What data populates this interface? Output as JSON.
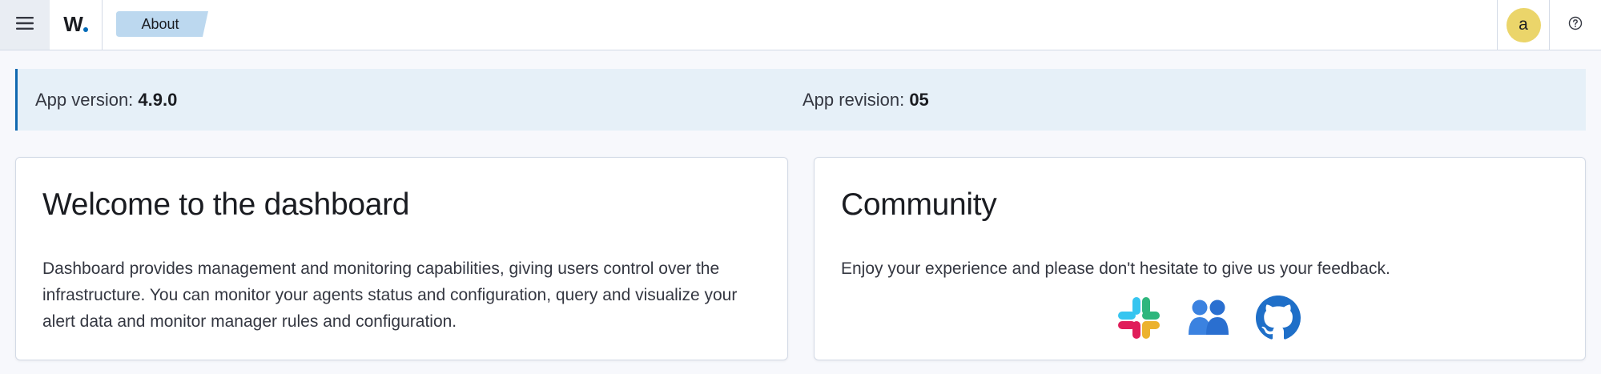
{
  "header": {
    "menu_icon": "hamburger-menu-icon",
    "logo_text": "W",
    "breadcrumb_label": "About",
    "avatar_initial": "a",
    "help_icon": "question-circle-icon"
  },
  "version": {
    "app_version_label": "App version:",
    "app_version_value": "4.9.0",
    "app_revision_label": "App revision:",
    "app_revision_value": "05"
  },
  "welcome": {
    "title": "Welcome to the dashboard",
    "text": "Dashboard provides management and monitoring capabilities, giving users control over the infrastructure. You can monitor your agents status and configuration, query and visualize your alert data and monitor manager rules and configuration."
  },
  "community": {
    "title": "Community",
    "text": "Enjoy your experience and please don't hesitate to give us your feedback.",
    "links": [
      {
        "icon": "slack-icon"
      },
      {
        "icon": "users-group-icon"
      },
      {
        "icon": "github-icon"
      }
    ]
  },
  "colors": {
    "accent": "#0f68b0",
    "banner_bg": "#e6f0f8",
    "breadcrumb_bg": "#bcd8ef",
    "avatar_bg": "#ebd56a",
    "page_bg": "#f7f8fc"
  }
}
